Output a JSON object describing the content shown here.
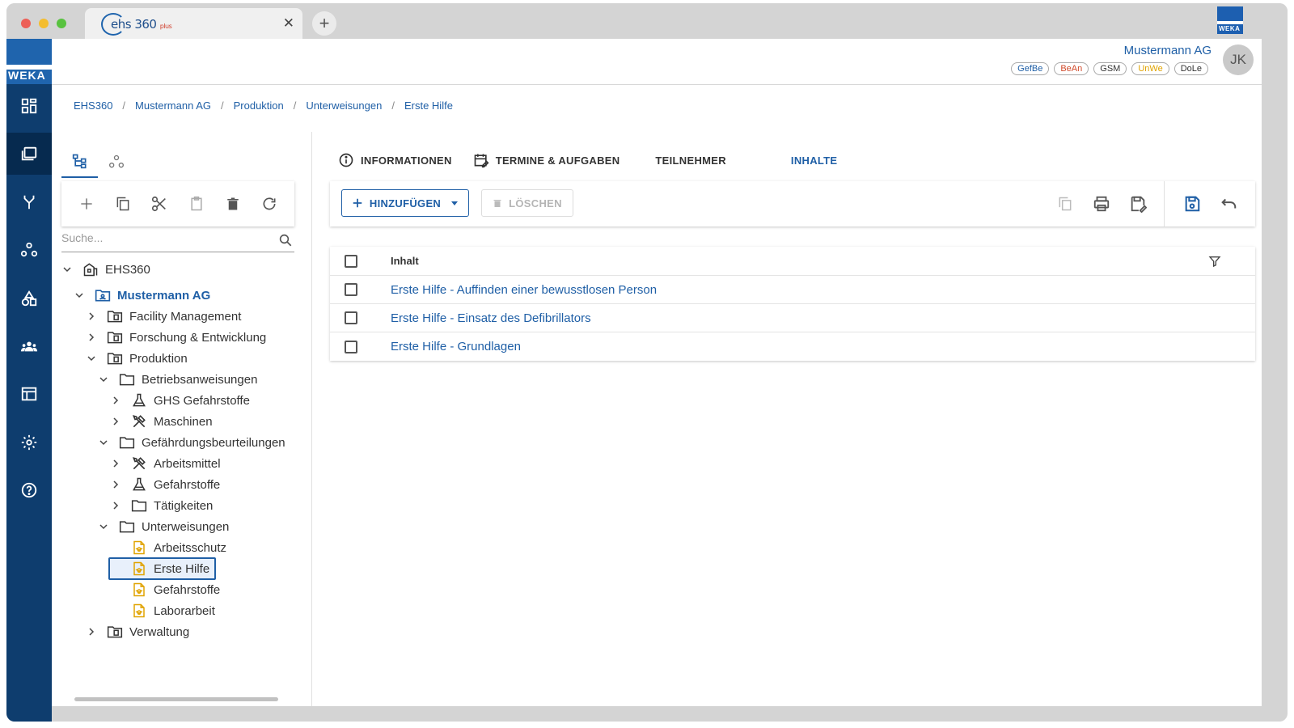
{
  "browser": {
    "tab_title": "ehs 360",
    "tab_title_suffix": "plus",
    "close_glyph": "✕",
    "new_tab_glyph": "+",
    "corner_logo": "WEKA"
  },
  "rail": {
    "logo": "WEKA",
    "items": [
      {
        "icon": "dashboard-icon"
      },
      {
        "icon": "folders-icon",
        "active": true
      },
      {
        "icon": "fork-icon"
      },
      {
        "icon": "org-icon"
      },
      {
        "icon": "shapes-icon"
      },
      {
        "icon": "people-icon"
      },
      {
        "icon": "table-icon"
      },
      {
        "icon": "gear-icon"
      },
      {
        "icon": "help-icon"
      }
    ]
  },
  "header": {
    "company": "Mustermann AG",
    "badges": [
      {
        "label": "GefBe",
        "color": "#1f5fa6"
      },
      {
        "label": "BeAn",
        "color": "#d04a2a"
      },
      {
        "label": "GSM",
        "color": "#333333"
      },
      {
        "label": "UnWe",
        "color": "#e0a300"
      },
      {
        "label": "DoLe",
        "color": "#333333"
      }
    ],
    "avatar": "JK"
  },
  "breadcrumb": [
    "EHS360",
    "Mustermann AG",
    "Produktion",
    "Unterweisungen",
    "Erste Hilfe"
  ],
  "breadcrumb_sep": "/",
  "left_panel": {
    "search_placeholder": "Suche...",
    "tree": [
      {
        "label": "EHS360",
        "icon": "building-icon",
        "expanded": true
      },
      {
        "label": "Mustermann AG",
        "icon": "company-folder-icon",
        "expanded": true,
        "bold": true
      },
      {
        "label": "Facility Management",
        "icon": "folder-doc-icon",
        "expanded": false
      },
      {
        "label": "Forschung & Entwicklung",
        "icon": "folder-doc-icon",
        "expanded": false
      },
      {
        "label": "Produktion",
        "icon": "folder-doc-icon",
        "expanded": true
      },
      {
        "label": "Betriebsanweisungen",
        "icon": "folder-icon",
        "expanded": true
      },
      {
        "label": "GHS Gefahrstoffe",
        "icon": "flask-icon",
        "expanded": false
      },
      {
        "label": "Maschinen",
        "icon": "tools-icon",
        "expanded": false
      },
      {
        "label": "Gefährdungsbeurteilungen",
        "icon": "folder-icon",
        "expanded": true
      },
      {
        "label": "Arbeitsmittel",
        "icon": "tools-icon",
        "expanded": false
      },
      {
        "label": "Gefahrstoffe",
        "icon": "flask-icon",
        "expanded": false
      },
      {
        "label": "Tätigkeiten",
        "icon": "folder-icon",
        "expanded": false
      },
      {
        "label": "Unterweisungen",
        "icon": "folder-icon",
        "expanded": true
      },
      {
        "label": "Arbeitsschutz",
        "icon": "instruction-doc-icon"
      },
      {
        "label": "Erste Hilfe",
        "icon": "instruction-doc-icon",
        "selected": true
      },
      {
        "label": "Gefahrstoffe",
        "icon": "instruction-doc-icon"
      },
      {
        "label": "Laborarbeit",
        "icon": "instruction-doc-icon"
      },
      {
        "label": "Verwaltung",
        "icon": "folder-doc-icon",
        "expanded": false
      }
    ]
  },
  "content": {
    "tabs": [
      {
        "label": "INFORMATIONEN",
        "icon": "info-icon"
      },
      {
        "label": "TERMINE & AUFGABEN",
        "icon": "calendar-edit-icon"
      },
      {
        "label": "TEILNEHMER"
      },
      {
        "label": "INHALTE",
        "active": true
      }
    ],
    "toolbar": {
      "add_label": "HINZUFÜGEN",
      "delete_label": "LÖSCHEN"
    },
    "table": {
      "header": "Inhalt",
      "rows": [
        "Erste Hilfe - Auffinden einer bewusstlosen Person",
        "Erste Hilfe - Einsatz des Defibrillators",
        "Erste Hilfe - Grundlagen"
      ]
    }
  },
  "colors": {
    "accent": "#1f5fa6",
    "rail": "#0e3d6e",
    "instruction_icon": "#e0a300"
  }
}
